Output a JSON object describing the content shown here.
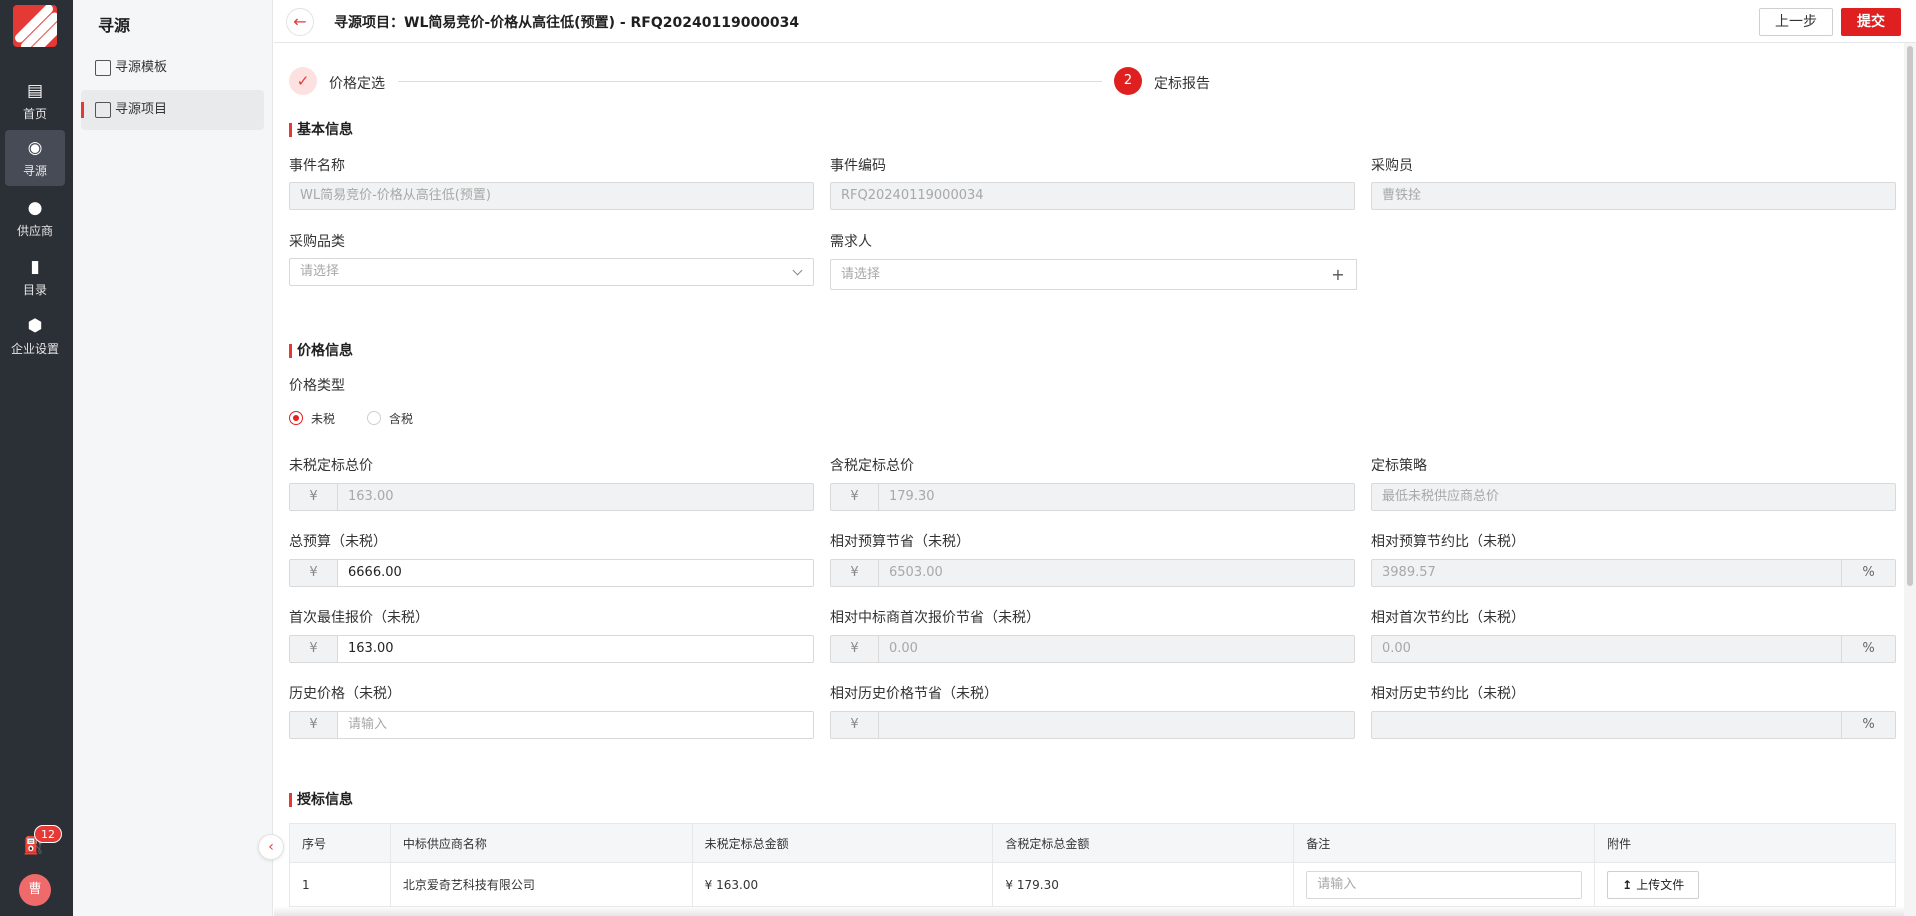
{
  "rail": {
    "items": [
      {
        "label": "首页",
        "icon": "home-icon"
      },
      {
        "label": "寻源",
        "icon": "sourcing-icon"
      },
      {
        "label": "供应商",
        "icon": "supplier-icon"
      },
      {
        "label": "目录",
        "icon": "catalog-icon"
      },
      {
        "label": "企业设置",
        "icon": "settings-icon"
      }
    ],
    "active": "寻源",
    "notification_count": "12",
    "avatar_text": "曹",
    "accent_color": "#e02020"
  },
  "subnav": {
    "title": "寻源",
    "items": [
      {
        "label": "寻源模板",
        "icon": "template-grid-icon"
      },
      {
        "label": "寻源项目",
        "icon": "project-chat-icon"
      }
    ],
    "active": "寻源项目"
  },
  "header": {
    "title": "寻源项目：WL简易竞价-价格从高往低(预置) - RFQ20240119000034",
    "prev_label": "上一步",
    "submit_label": "提交"
  },
  "steps": [
    {
      "number": "✓",
      "label": "价格定选",
      "status": "done"
    },
    {
      "number": "2",
      "label": "定标报告",
      "status": "current"
    }
  ],
  "basic_info": {
    "title": "基本信息",
    "event_name_label": "事件名称",
    "event_name_value": "WL简易竞价-价格从高往低(预置)",
    "event_code_label": "事件编码",
    "event_code_value": "RFQ20240119000034",
    "buyer_label": "采购员",
    "buyer_value": "曹铁拴",
    "category_label": "采购品类",
    "category_placeholder": "请选择",
    "requester_label": "需求人",
    "requester_placeholder": "请选择",
    "add_symbol": "+"
  },
  "price_info": {
    "title": "价格信息",
    "price_type_label": "价格类型",
    "price_type_options": [
      "未税",
      "含税"
    ],
    "price_type_selected": "未税",
    "currency_symbol": "¥",
    "percent_symbol": "%",
    "untaxed_total_label": "未税定标总价",
    "untaxed_total_value": "163.00",
    "taxed_total_label": "含税定标总价",
    "taxed_total_value": "179.30",
    "strategy_label": "定标策略",
    "strategy_value": "最低未税供应商总价",
    "budget_label": "总预算（未税）",
    "budget_value": "6666.00",
    "budget_saving_label": "相对预算节省（未税）",
    "budget_saving_value": "6503.00",
    "budget_saving_ratio_label": "相对预算节约比（未税）",
    "budget_saving_ratio_value": "3989.57",
    "first_best_label": "首次最佳报价（未税）",
    "first_best_value": "163.00",
    "winner_first_saving_label": "相对中标商首次报价节省（未税）",
    "winner_first_saving_value": "0.00",
    "first_saving_ratio_label": "相对首次节约比（未税）",
    "first_saving_ratio_value": "0.00",
    "history_label": "历史价格（未税）",
    "history_placeholder": "请输入",
    "history_saving_label": "相对历史价格节省（未税）",
    "history_saving_value": "",
    "history_saving_ratio_label": "相对历史节约比（未税）",
    "history_saving_ratio_value": ""
  },
  "award_info": {
    "title": "授标信息",
    "columns": [
      "序号",
      "中标供应商名称",
      "未税定标总金额",
      "含税定标总金额",
      "备注",
      "附件"
    ],
    "rows": [
      {
        "index": "1",
        "supplier": "北京爱奇艺科技有限公司",
        "untaxed": "¥ 163.00",
        "taxed": "¥ 179.30",
        "remark_placeholder": "请输入",
        "upload_label": "上传文件"
      }
    ]
  }
}
